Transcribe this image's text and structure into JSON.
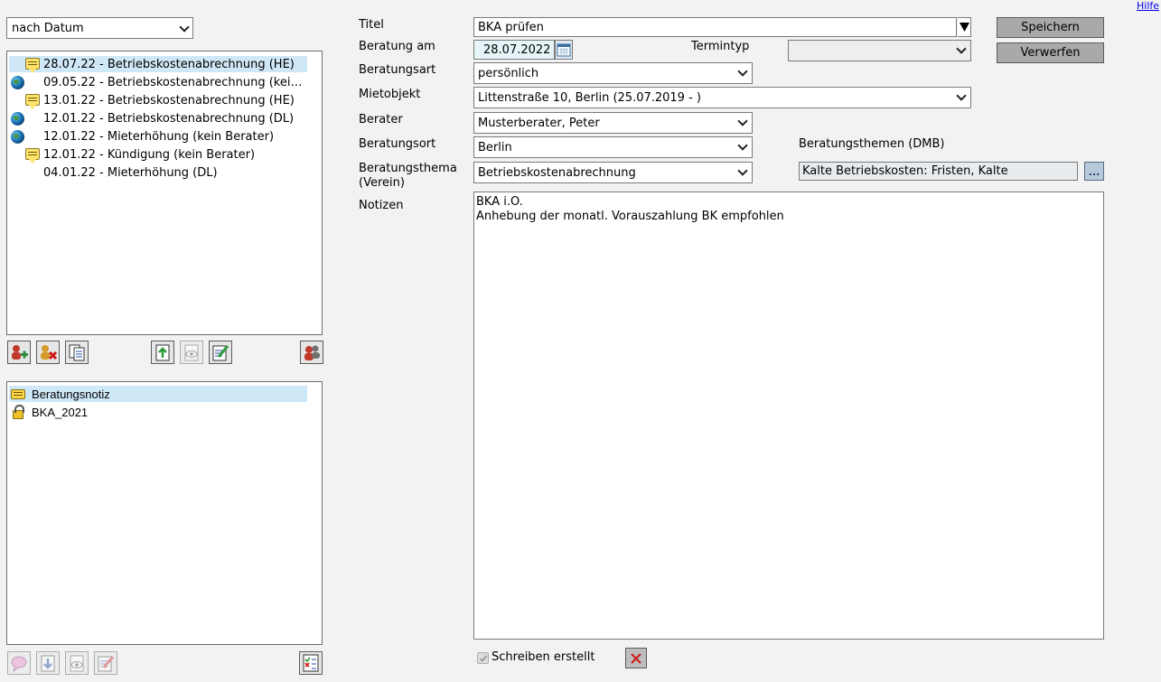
{
  "header": {
    "help_link": "Hilfe"
  },
  "sidebar": {
    "sort_select": "nach Datum",
    "consultations": [
      {
        "label": "28.07.22 - Betriebskostenabrechnung (HE)",
        "icons": [
          "note"
        ],
        "selected": true
      },
      {
        "label": "09.05.22 - Betriebskostenabrechnung (kei…",
        "icons": [
          "globe"
        ],
        "selected": false
      },
      {
        "label": "13.01.22 - Betriebskostenabrechnung (HE)",
        "icons": [
          "note"
        ],
        "selected": false
      },
      {
        "label": "12.01.22 - Betriebskostenabrechnung (DL)",
        "icons": [
          "globe"
        ],
        "selected": false
      },
      {
        "label": "12.01.22 - Mieterhöhung (kein Berater)",
        "icons": [
          "globe"
        ],
        "selected": false
      },
      {
        "label": "12.01.22 - Kündigung (kein Berater)",
        "icons": [
          "note"
        ],
        "selected": false
      },
      {
        "label": "04.01.22 - Mieterhöhung (DL)",
        "icons": [],
        "selected": false
      }
    ],
    "documents": [
      {
        "label": "Beratungsnotiz",
        "icon": "message-icon",
        "selected": true
      },
      {
        "label": "BKA_2021",
        "icon": "lock-icon",
        "selected": false
      }
    ]
  },
  "form": {
    "title_label": "Titel",
    "title_value": "BKA prüfen",
    "date_label": "Beratung am",
    "date_value": "28.07.2022",
    "termintyp_label": "Termintyp",
    "termintyp_value": "",
    "art_label": "Beratungsart",
    "art_value": "persönlich",
    "mietobjekt_label": "Mietobjekt",
    "mietobjekt_value": "Littenstraße 10, Berlin (25.07.2019 - )",
    "berater_label": "Berater",
    "berater_value": "Musterberater, Peter",
    "ort_label": "Beratungsort",
    "ort_value": "Berlin",
    "themen_dmb_label": "Beratungsthemen (DMB)",
    "themen_dmb_value": "Kalte Betriebskosten: Fristen, Kalte",
    "themen_dmb_button": "...",
    "thema_label_1": "Beratungsthema",
    "thema_label_2": "(Verein)",
    "thema_value": "Betriebskostenabrechnung",
    "notes_label": "Notizen",
    "notes_value": "BKA i.O.\nAnhebung der monatl. Vorauszahlung BK empfohlen",
    "schreiben_label": "Schreiben erstellt"
  },
  "actions": {
    "save": "Speichern",
    "discard": "Verwerfen"
  },
  "colors": {
    "selection": "#cfe8f7",
    "button_gray": "#a9a9a9",
    "background": "#f2f2f2",
    "date_field": "#e6f6f8"
  }
}
